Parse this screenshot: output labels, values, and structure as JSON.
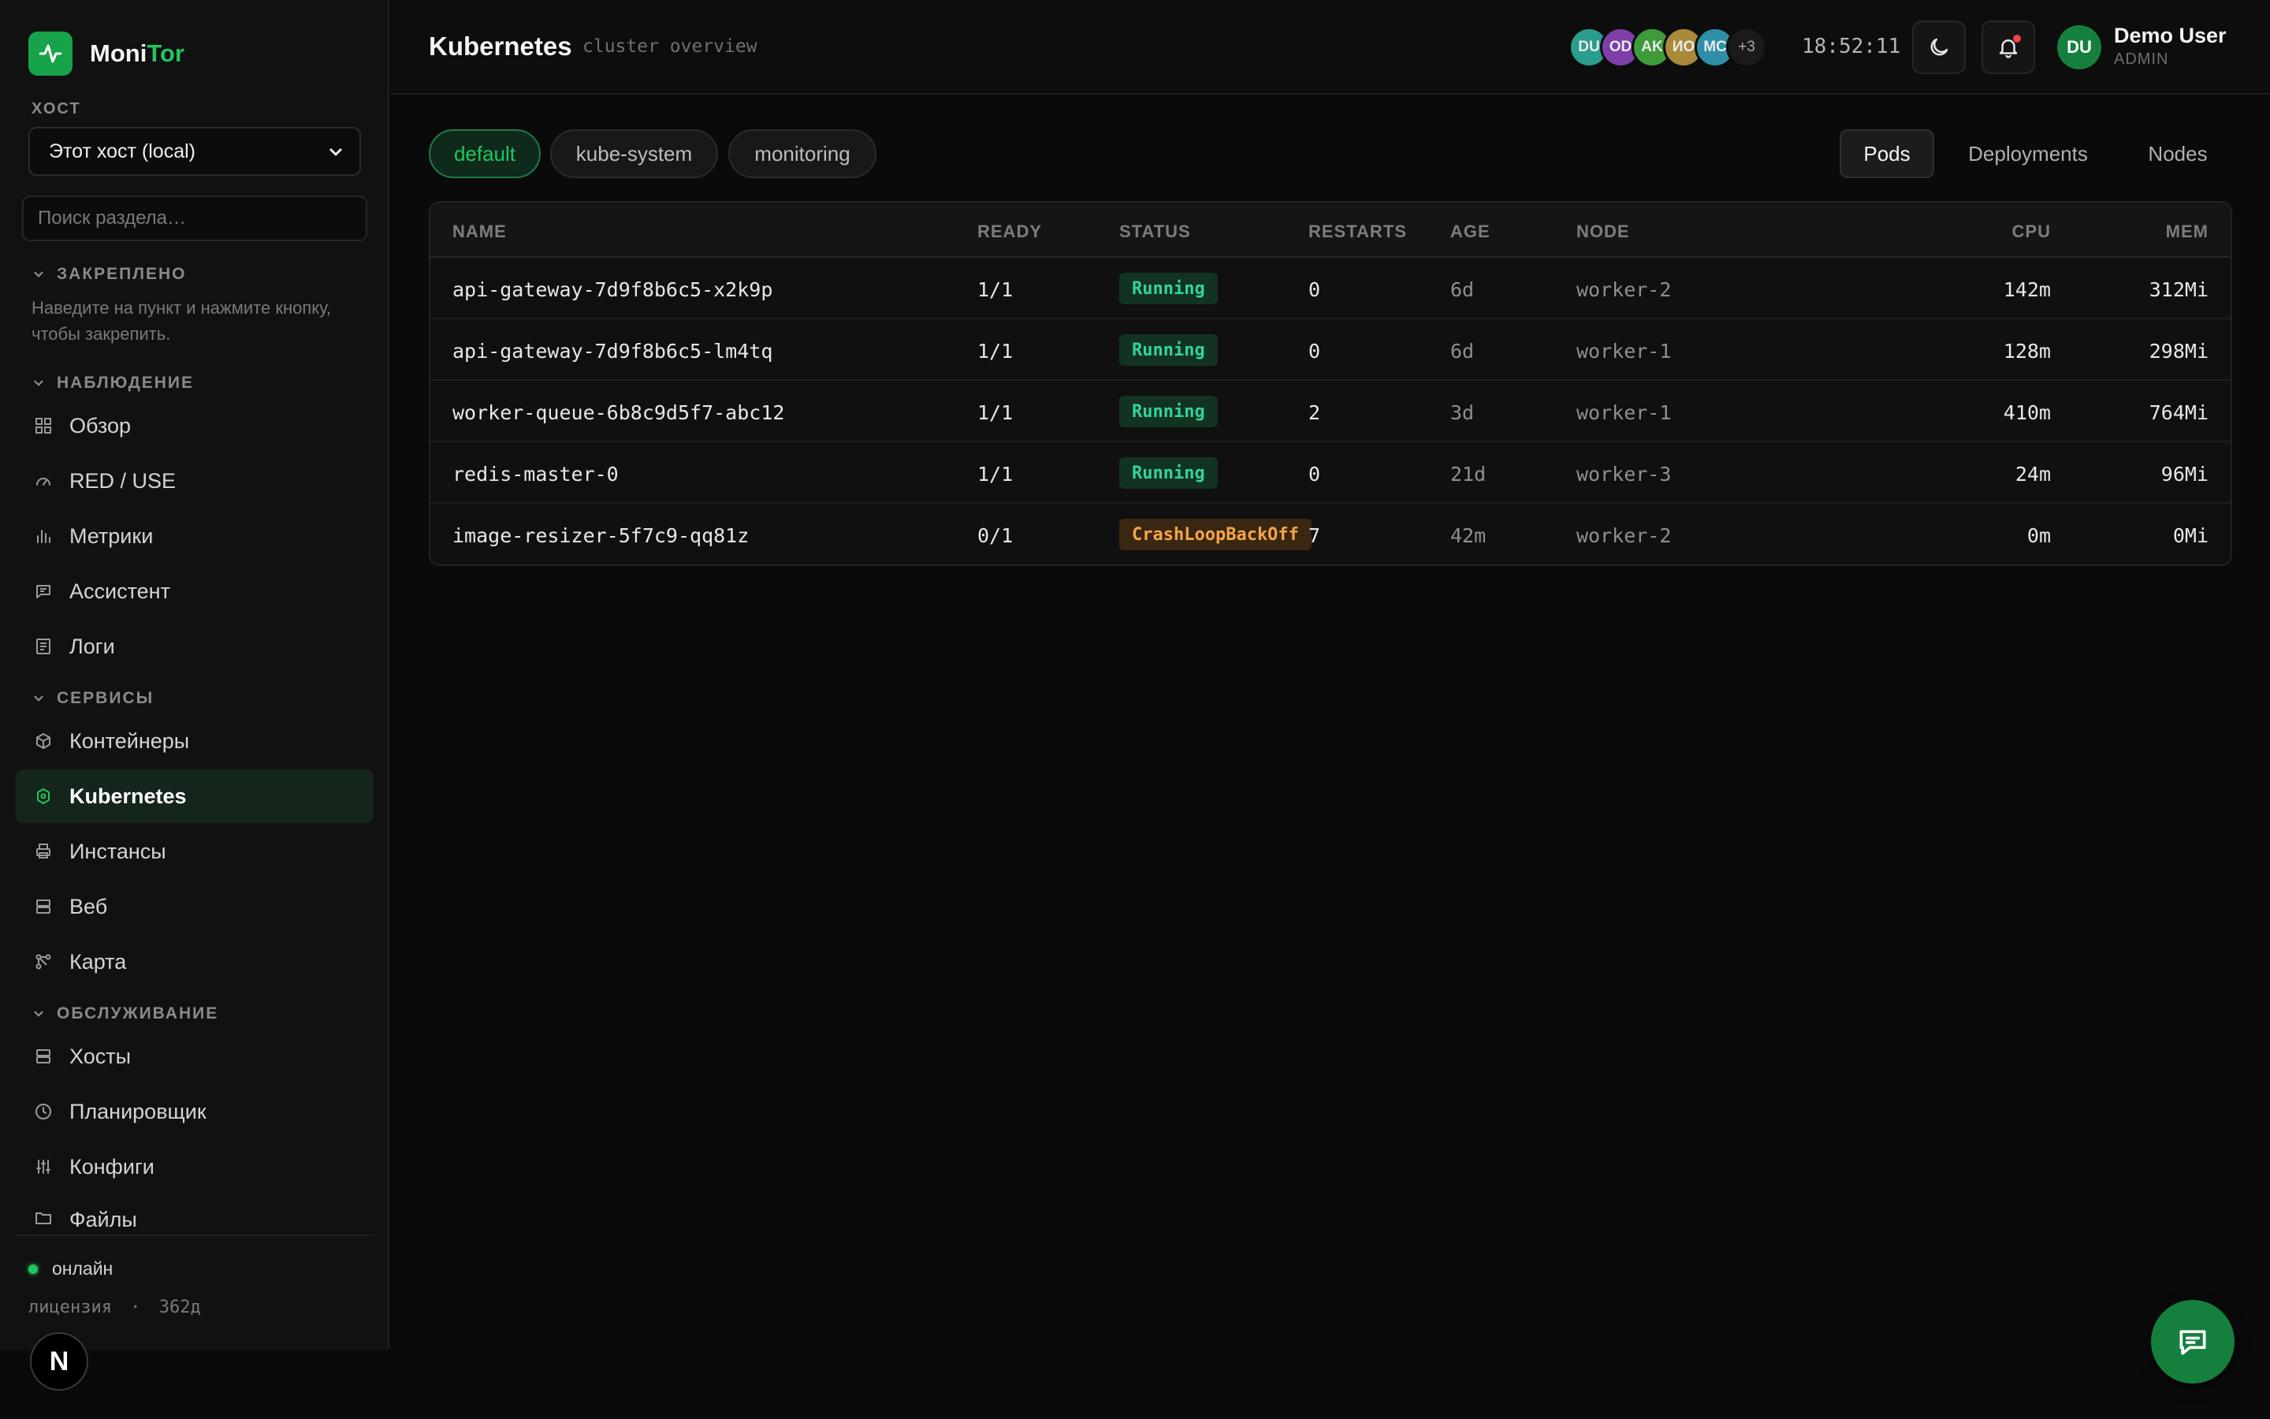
{
  "brand": {
    "name_main": "Moni",
    "name_accent": "Tor",
    "accent_color": "#22c55e"
  },
  "sidebar": {
    "host_label": "ХОСТ",
    "host_value": "Этот хост (local)",
    "search_placeholder": "Поиск раздела…",
    "sections": {
      "pinned": {
        "title": "ЗАКРЕПЛЕНО",
        "hint": "Наведите на пункт и нажмите кнопку, чтобы закрепить."
      },
      "observe": {
        "title": "НАБЛЮДЕНИЕ"
      },
      "services": {
        "title": "СЕРВИСЫ"
      },
      "maintenance": {
        "title": "ОБСЛУЖИВАНИЕ"
      }
    },
    "items": [
      {
        "label": "Обзор",
        "icon": "grid-icon"
      },
      {
        "label": "RED / USE",
        "icon": "gauge-icon"
      },
      {
        "label": "Метрики",
        "icon": "bar-chart-icon"
      },
      {
        "label": "Ассистент",
        "icon": "chat-icon"
      },
      {
        "label": "Логи",
        "icon": "document-icon"
      },
      {
        "label": "Контейнеры",
        "icon": "box-icon"
      },
      {
        "label": "Kubernetes",
        "icon": "kubernetes-icon",
        "active": true
      },
      {
        "label": "Инстансы",
        "icon": "printer-icon"
      },
      {
        "label": "Веб",
        "icon": "server-icon"
      },
      {
        "label": "Карта",
        "icon": "network-icon"
      },
      {
        "label": "Хосты",
        "icon": "server-icon"
      },
      {
        "label": "Планировщик",
        "icon": "clock-icon"
      },
      {
        "label": "Конфиги",
        "icon": "sliders-icon"
      },
      {
        "label": "Файлы",
        "icon": "folder-icon"
      }
    ],
    "status": "онлайн",
    "license_label": "лицензия",
    "license_days": "362д"
  },
  "header": {
    "title": "Kubernetes",
    "subtitle": "cluster overview",
    "avatars": [
      {
        "initials": "DU",
        "color": "#2a9d8f"
      },
      {
        "initials": "OD",
        "color": "#7e3fa8"
      },
      {
        "initials": "AK",
        "color": "#3f9a3a"
      },
      {
        "initials": "ИО",
        "color": "#a88a3a"
      },
      {
        "initials": "MC",
        "color": "#2f8fa8"
      }
    ],
    "avatars_more": "+3",
    "clock": "18:52:11",
    "user": {
      "initials": "DU",
      "name": "Demo User",
      "role": "ADMIN"
    }
  },
  "namespaces": [
    "default",
    "kube-system",
    "monitoring"
  ],
  "active_namespace": "default",
  "views": [
    "Pods",
    "Deployments",
    "Nodes"
  ],
  "active_view": "Pods",
  "table": {
    "columns": [
      "NAME",
      "READY",
      "STATUS",
      "RESTARTS",
      "AGE",
      "NODE",
      "CPU",
      "MEM"
    ],
    "rows": [
      {
        "name": "api-gateway-7d9f8b6c5-x2k9p",
        "ready": "1/1",
        "status": "Running",
        "restarts": "0",
        "age": "6d",
        "node": "worker-2",
        "cpu": "142m",
        "mem": "312Mi"
      },
      {
        "name": "api-gateway-7d9f8b6c5-lm4tq",
        "ready": "1/1",
        "status": "Running",
        "restarts": "0",
        "age": "6d",
        "node": "worker-1",
        "cpu": "128m",
        "mem": "298Mi"
      },
      {
        "name": "worker-queue-6b8c9d5f7-abc12",
        "ready": "1/1",
        "status": "Running",
        "restarts": "2",
        "age": "3d",
        "node": "worker-1",
        "cpu": "410m",
        "mem": "764Mi"
      },
      {
        "name": "redis-master-0",
        "ready": "1/1",
        "status": "Running",
        "restarts": "0",
        "age": "21d",
        "node": "worker-3",
        "cpu": "24m",
        "mem": "96Mi"
      },
      {
        "name": "image-resizer-5f7c9-qq81z",
        "ready": "0/1",
        "status": "CrashLoopBackOff",
        "restarts": "7",
        "age": "42m",
        "node": "worker-2",
        "cpu": "0m",
        "mem": "0Mi"
      }
    ]
  },
  "next_badge": "N",
  "colors": {
    "bg": "#0a0a0a",
    "sidebar": "#111111",
    "running": "#34d399",
    "crash": "#f5a54a",
    "accent": "#22c55e"
  }
}
